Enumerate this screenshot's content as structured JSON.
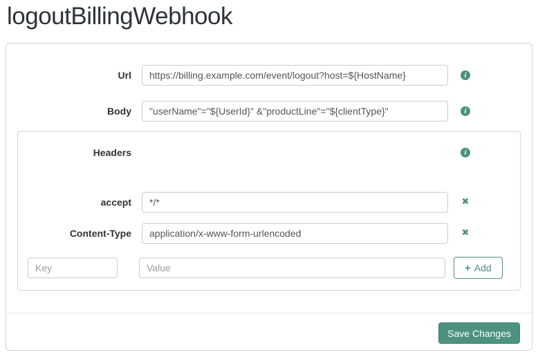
{
  "title": "logoutBillingWebhook",
  "form": {
    "url_label": "Url",
    "url_value": "https://billing.example.com/event/logout?host=${HostName}",
    "body_label": "Body",
    "body_value": "\"userName\"=\"${UserId}\" &\"productLine\"=\"${clientType}\""
  },
  "headers": {
    "title": "Headers",
    "rows": [
      {
        "key": "accept",
        "value": "*/*"
      },
      {
        "key": "Content-Type",
        "value": "application/x-www-form-urlencoded"
      }
    ],
    "key_placeholder": "Key",
    "value_placeholder": "Value",
    "add_button": {
      "plus": "+",
      "label": "Add"
    }
  },
  "footer": {
    "save_button": "Save Changes"
  },
  "icons": {
    "info_glyph": "i",
    "remove_glyph": "✖"
  },
  "colors": {
    "accent": "#4d9180",
    "panel_border": "#d5d5d5",
    "input_border": "#cccccc",
    "label_text": "#333333",
    "input_text": "#555555"
  }
}
